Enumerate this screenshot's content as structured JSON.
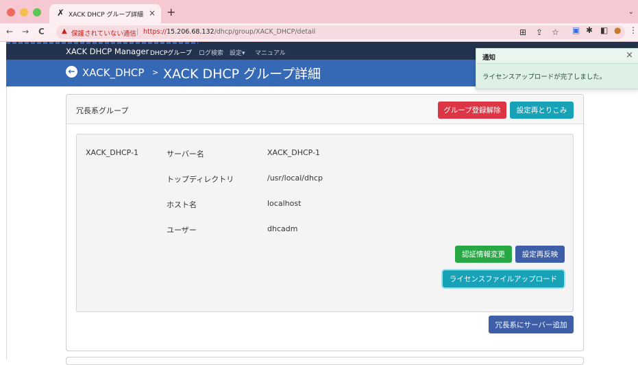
{
  "browser": {
    "tab_title": "XACK DHCP グループ詳細",
    "tab_close": "×",
    "new_tab": "+",
    "tab_menu": "⌄",
    "back": "←",
    "forward": "→",
    "reload": "C",
    "security_warning": "保護されていない通信",
    "url_scheme": "https://",
    "url_host": "15.206.68.132",
    "url_path": "/dhcp/group/XACK_DHCP/detail"
  },
  "app_nav": {
    "brand": "XACK DHCP Manager",
    "links": [
      "DHCPグループ",
      "ログ検索",
      "設定▾",
      "マニュアル"
    ]
  },
  "hero": {
    "group": "XACK_DHCP",
    "separator": ">",
    "title": "XACK DHCP グループ詳細"
  },
  "card": {
    "title": "冗長系グループ",
    "unregister_button": "グループ登録解除",
    "reload_settings_button": "設定再とりこみ",
    "server": {
      "name": "XACK_DHCP-1",
      "rows": [
        {
          "label": "サーバー名",
          "value": "XACK_DHCP-1"
        },
        {
          "label": "トップディレクトリ",
          "value": "/usr/local/dhcp"
        },
        {
          "label": "ホスト名",
          "value": "localhost"
        },
        {
          "label": "ユーザー",
          "value": "dhcadm"
        }
      ],
      "change_auth_button": "認証情報変更",
      "reapply_settings_button": "設定再反映",
      "upload_license_button": "ライセンスファイルアップロード"
    },
    "add_server_button": "冗長系にサーバー追加"
  },
  "toast": {
    "title": "通知",
    "close": "×",
    "message": "ライセンスアップロードが完了しました。"
  },
  "colors": {
    "nav_bg": "#22324f",
    "hero_bg": "#3568b5",
    "danger": "#dc3545",
    "info": "#17a2b8",
    "success": "#28a745",
    "primary": "#3e5fa8",
    "toast_bg": "#dff0e7"
  }
}
